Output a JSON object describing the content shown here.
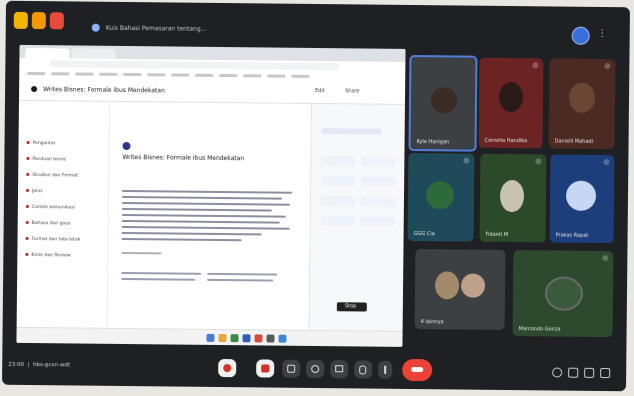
{
  "meeting": {
    "title": "Kuis Bahasi Pemasaran tentang...",
    "time": "23:00",
    "meeting_code": "hbs-gcxn-wdt"
  },
  "share": {
    "doc_title": "Writes Bisnes: Formale ibus Mendekatan",
    "doc_heading": "Writes Bisnes: Formale ibus Mendekatan",
    "header_buttons": [
      "Edit",
      "Share"
    ],
    "nav_items": [
      "Pengantar",
      "Panduan bisnis",
      "Struktur dan Format",
      "Jenis",
      "Contoh komunikasi",
      "Bahasa dan gaya",
      "Format dan tata letak",
      "Kirim dan Review"
    ],
    "tooltip": "Stop"
  },
  "participants": [
    {
      "name": "Kyle Hanigan",
      "mic": "on",
      "color": "#1e3a5a",
      "active": true
    },
    {
      "name": "Cornelia Handika",
      "mic": "off",
      "color": "#6b2323",
      "active": false
    },
    {
      "name": "Danielli Mahadi",
      "mic": "off",
      "color": "#4a2a22",
      "active": false
    },
    {
      "name": "GGG Cia",
      "mic": "off",
      "color": "#1f4a5a",
      "active": false
    },
    {
      "name": "Fidanti M",
      "mic": "off",
      "color": "#2c4a2a",
      "active": false
    },
    {
      "name": "Prakas Rapat",
      "mic": "off",
      "color": "#1c3e7a",
      "active": false
    },
    {
      "name": "4 lainnya",
      "mic": "off",
      "color": "#3c4043",
      "active": false
    },
    {
      "name": "Marcondo Gonza",
      "mic": "off",
      "color": "#2e4a2e",
      "active": false
    }
  ],
  "colors": {
    "end_call": "#ea4335",
    "meet_bg": "#1f2023",
    "tile_bg": "#3c4043"
  }
}
